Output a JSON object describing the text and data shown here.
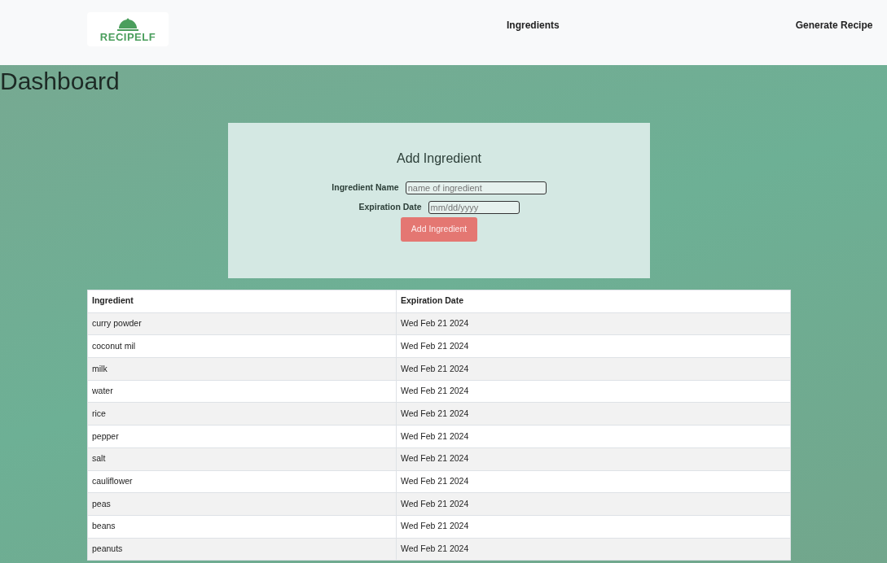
{
  "navbar": {
    "logo_text": "RECIPELF",
    "links": [
      "Ingredients",
      "Generate Recipe"
    ]
  },
  "heading": "Dashboard",
  "form": {
    "title": "Add Ingredient",
    "name_label": "Ingredient Name",
    "name_placeholder": "name of ingredient",
    "date_label": "Expiration Date",
    "date_placeholder": "mm/dd/yyyy",
    "button": "Add Ingredient"
  },
  "table": {
    "columns": [
      "Ingredient",
      "Expiration Date"
    ],
    "rows": [
      [
        "curry powder",
        "Wed Feb 21 2024"
      ],
      [
        "coconut mil",
        "Wed Feb 21 2024"
      ],
      [
        "milk",
        "Wed Feb 21 2024"
      ],
      [
        "water",
        "Wed Feb 21 2024"
      ],
      [
        "rice",
        "Wed Feb 21 2024"
      ],
      [
        "pepper",
        "Wed Feb 21 2024"
      ],
      [
        "salt",
        "Wed Feb 21 2024"
      ],
      [
        "cauliflower",
        "Wed Feb 21 2024"
      ],
      [
        "peas",
        "Wed Feb 21 2024"
      ],
      [
        "beans",
        "Wed Feb 21 2024"
      ],
      [
        "peanuts",
        "Wed Feb 21 2024"
      ]
    ]
  }
}
